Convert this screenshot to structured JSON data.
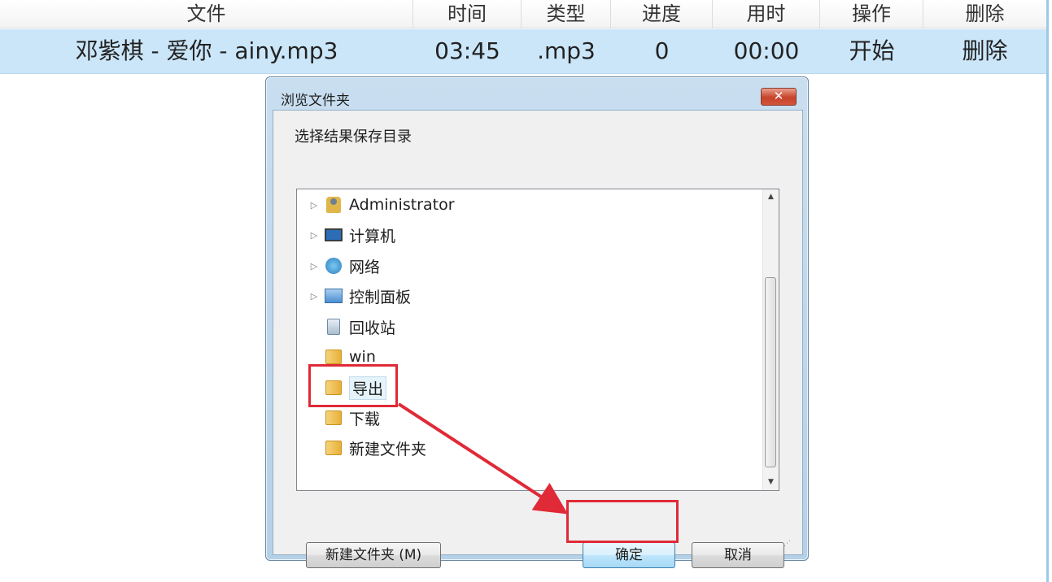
{
  "table": {
    "headers": [
      "文件",
      "时间",
      "类型",
      "进度",
      "用时",
      "操作",
      "删除"
    ],
    "row": {
      "file": "邓紫棋 - 爱你 - ainy.mp3",
      "time": "03:45",
      "type": ".mp3",
      "progress": "0",
      "elapsed": "00:00",
      "action": "开始",
      "delete": "删除"
    }
  },
  "dialog": {
    "title": "浏览文件夹",
    "close_label": "✕",
    "prompt": "选择结果保存目录",
    "tree": [
      {
        "label": "Administrator",
        "icon": "user-folder-icon",
        "expandable": true
      },
      {
        "label": "计算机",
        "icon": "computer-icon",
        "expandable": true
      },
      {
        "label": "网络",
        "icon": "network-icon",
        "expandable": true
      },
      {
        "label": "控制面板",
        "icon": "control-panel-icon",
        "expandable": true
      },
      {
        "label": "回收站",
        "icon": "recycle-bin-icon",
        "expandable": false
      },
      {
        "label": "win",
        "icon": "folder-icon",
        "expandable": false
      },
      {
        "label": "导出",
        "icon": "folder-icon",
        "expandable": false,
        "selected": true
      },
      {
        "label": "下载",
        "icon": "folder-icon",
        "expandable": false
      },
      {
        "label": "新建文件夹",
        "icon": "folder-icon",
        "expandable": false
      }
    ],
    "buttons": {
      "new_folder": "新建文件夹 (M)",
      "ok": "确定",
      "cancel": "取消"
    }
  },
  "colors": {
    "row_highlight": "#cbe6f9",
    "annotation_red": "#e02a37"
  }
}
